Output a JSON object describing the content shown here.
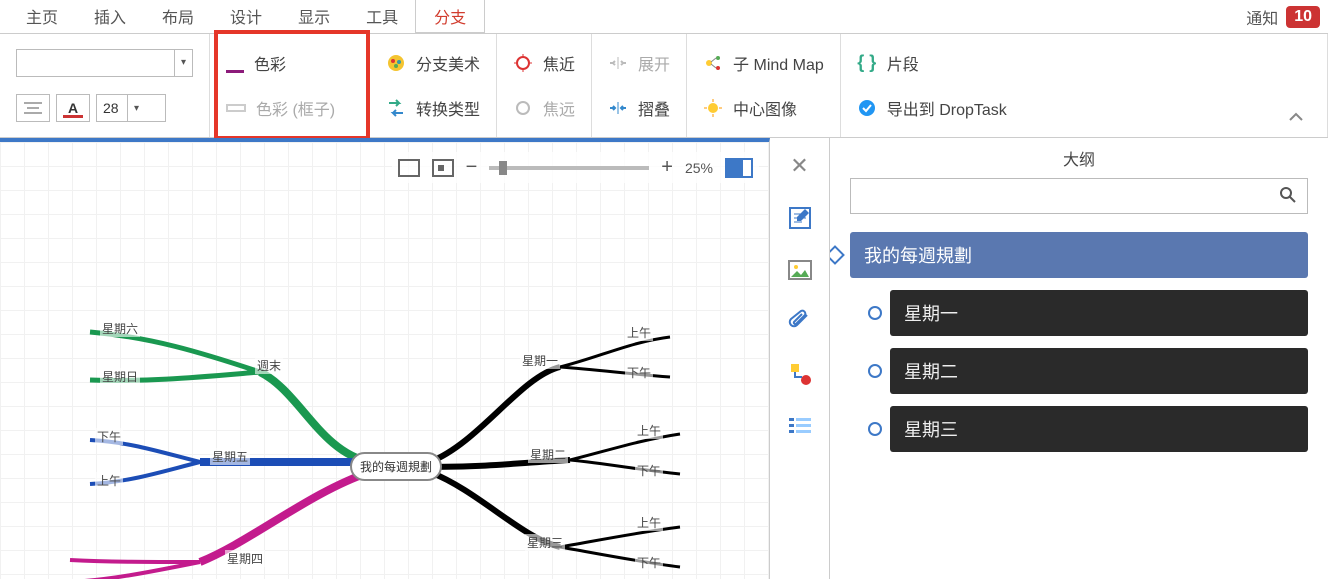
{
  "menu": {
    "tabs": [
      "主页",
      "插入",
      "布局",
      "设计",
      "显示",
      "工具",
      "分支"
    ],
    "active_index": 6,
    "notif_label": "通知",
    "notif_count": "10"
  },
  "ribbon": {
    "font_size": "28",
    "color_label": "色彩",
    "color_box_label": "色彩 (框子)",
    "branch_art_label": "分支美术",
    "convert_type_label": "转换类型",
    "focus_near_label": "焦近",
    "focus_far_label": "焦远",
    "expand_label": "展开",
    "collapse_label": "摺叠",
    "sub_mindmap_label": "子 Mind Map",
    "center_image_label": "中心图像",
    "fragment_label": "片段",
    "export_droptask_label": "导出到 DropTask"
  },
  "canvas": {
    "zoom_label": "25%",
    "central_label": "我的每週規劃",
    "branches": {
      "left_top1": "星期六",
      "left_top2": "星期日",
      "left_top_group": "週末",
      "left_mid": "星期五",
      "left_mid_am": "上午",
      "left_mid_pm": "下午",
      "left_bottom": "星期四",
      "right1": "星期一",
      "right1_am": "上午",
      "right1_pm": "下午",
      "right2": "星期二",
      "right2_am": "上午",
      "right2_pm": "下午",
      "right3": "星期三",
      "right3_am": "上午",
      "right3_pm": "下午"
    }
  },
  "outline": {
    "title": "大纲",
    "search_placeholder": "",
    "root": "我的每週規劃",
    "children": [
      "星期一",
      "星期二",
      "星期三"
    ]
  },
  "icons": {
    "search": "search-icon",
    "close": "close-icon"
  }
}
